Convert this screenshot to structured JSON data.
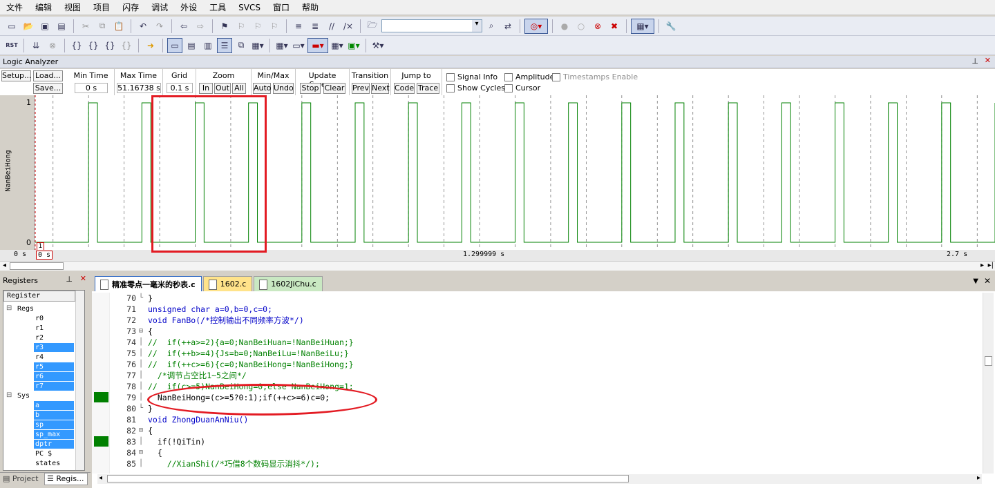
{
  "menu": [
    "文件",
    "编辑",
    "视图",
    "项目",
    "闪存",
    "调试",
    "外设",
    "工具",
    "SVCS",
    "窗口",
    "帮助"
  ],
  "logic_analyzer": {
    "title": "Logic Analyzer",
    "setup": "Setup...",
    "load": "Load...",
    "save": "Save...",
    "min_time_label": "Min Time",
    "min_time_value": "0 s",
    "max_time_label": "Max Time",
    "max_time_value": "51.16738 s",
    "grid_label": "Grid",
    "grid_value": "0.1 s",
    "zoom_label": "Zoom",
    "zoom_in": "In",
    "zoom_out": "Out",
    "zoom_all": "All",
    "minmax_label": "Min/Max",
    "auto": "Auto",
    "undo": "Undo",
    "update_label": "Update Screen",
    "stop": "Stop",
    "clear": "Clear",
    "transition_label": "Transition",
    "prev": "Prev",
    "next": "Next",
    "jump_label": "Jump to",
    "code": "Code",
    "trace": "Trace",
    "signal_info": "Signal Info",
    "show_cycles": "Show Cycles",
    "amplitude": "Amplitude",
    "cursor": "Cursor",
    "timestamps": "Timestamps Enable",
    "signal_name": "NanBeiHong",
    "y_high": "1",
    "y_low": "0",
    "marker": "1",
    "t_start": "0 s",
    "t_cursor": "0 s",
    "t_mid": "1.299999 s",
    "t_end": "2.7 s"
  },
  "waveform": {
    "signal": "NanBeiHong",
    "levels": [
      0,
      1
    ],
    "transitions_s": [
      0.0,
      0.15,
      0.175,
      0.3,
      0.325,
      0.45,
      0.475,
      0.6,
      0.625,
      0.75,
      0.775,
      0.9,
      0.925,
      1.05,
      1.075,
      1.2,
      1.225,
      1.35,
      1.375,
      1.5,
      1.525,
      1.65,
      1.675,
      1.8,
      1.825,
      1.95,
      1.975,
      2.1,
      2.125,
      2.25,
      2.275,
      2.4,
      2.425,
      2.55,
      2.575,
      2.7
    ],
    "start_level": 0,
    "x_range_s": [
      0,
      2.7
    ],
    "grid_s": 0.1
  },
  "registers": {
    "title": "Registers",
    "header": "Register",
    "items": [
      {
        "label": "Regs",
        "indent": 1,
        "hl": false
      },
      {
        "label": "r0",
        "indent": 3,
        "hl": false
      },
      {
        "label": "r1",
        "indent": 3,
        "hl": false
      },
      {
        "label": "r2",
        "indent": 3,
        "hl": false
      },
      {
        "label": "r3",
        "indent": 3,
        "hl": true
      },
      {
        "label": "r4",
        "indent": 3,
        "hl": false
      },
      {
        "label": "r5",
        "indent": 3,
        "hl": true
      },
      {
        "label": "r6",
        "indent": 3,
        "hl": true
      },
      {
        "label": "r7",
        "indent": 3,
        "hl": true
      },
      {
        "label": "Sys",
        "indent": 1,
        "hl": false
      },
      {
        "label": "a",
        "indent": 3,
        "hl": true
      },
      {
        "label": "b",
        "indent": 3,
        "hl": true
      },
      {
        "label": "sp",
        "indent": 3,
        "hl": true
      },
      {
        "label": "sp_max",
        "indent": 3,
        "hl": true
      },
      {
        "label": "dptr",
        "indent": 3,
        "hl": true
      },
      {
        "label": "PC  $",
        "indent": 3,
        "hl": false
      },
      {
        "label": "states",
        "indent": 3,
        "hl": false
      }
    ],
    "tab_project": "Project",
    "tab_regs": "Regis..."
  },
  "editor": {
    "tabs": [
      "精准零点一毫米的秒表.c",
      "1602.c",
      "1602JiChu.c"
    ],
    "lines": [
      {
        "n": "70",
        "t": "}",
        "cls": "",
        "bp": false,
        "fold": "└"
      },
      {
        "n": "71",
        "t": "unsigned char a=0,b=0,c=0;",
        "cls": "kw",
        "bp": false,
        "fold": ""
      },
      {
        "n": "72",
        "t": "void FanBo(/*控制输出不同频率方波*/)",
        "cls": "mix1",
        "bp": false,
        "fold": ""
      },
      {
        "n": "73",
        "t": "{",
        "cls": "",
        "bp": false,
        "fold": "⊟"
      },
      {
        "n": "74",
        "t": "//  if(++a>=2){a=0;NanBeiHuan=!NanBeiHuan;}",
        "cls": "cm",
        "bp": false,
        "fold": "│"
      },
      {
        "n": "75",
        "t": "//  if(++b>=4){Js=b=0;NanBeiLu=!NanBeiLu;}",
        "cls": "cm",
        "bp": false,
        "fold": "│"
      },
      {
        "n": "76",
        "t": "//  if(++c>=6){c=0;NanBeiHong=!NanBeiHong;}",
        "cls": "cm",
        "bp": false,
        "fold": "│"
      },
      {
        "n": "77",
        "t": "  /*调节占空比1~5之间*/",
        "cls": "cm",
        "bp": false,
        "fold": "│"
      },
      {
        "n": "78",
        "t": "//  if(c>=5)NanBeiHong=0;else NanBeiHong=1;",
        "cls": "cm",
        "bp": false,
        "fold": "│"
      },
      {
        "n": "79",
        "t": "  NanBeiHong=(c>=5?0:1);if(++c>=6)c=0;",
        "cls": "mix2",
        "bp": true,
        "fold": "│"
      },
      {
        "n": "80",
        "t": "}",
        "cls": "",
        "bp": false,
        "fold": "└"
      },
      {
        "n": "81",
        "t": "void ZhongDuanAnNiu()",
        "cls": "mix3",
        "bp": false,
        "fold": ""
      },
      {
        "n": "82",
        "t": "{",
        "cls": "",
        "bp": false,
        "fold": "⊟"
      },
      {
        "n": "83",
        "t": "  if(!QiTin)",
        "cls": "mix4",
        "bp": true,
        "fold": "│"
      },
      {
        "n": "84",
        "t": "  {",
        "cls": "",
        "bp": false,
        "fold": "⊟"
      },
      {
        "n": "85",
        "t": "    //XianShi(/*巧借8个数码显示消抖*/);",
        "cls": "cm",
        "bp": false,
        "fold": "│"
      }
    ]
  },
  "colors": {
    "wave": "#008000",
    "highlight": "#3399ff",
    "annotation": "#e31b23"
  }
}
